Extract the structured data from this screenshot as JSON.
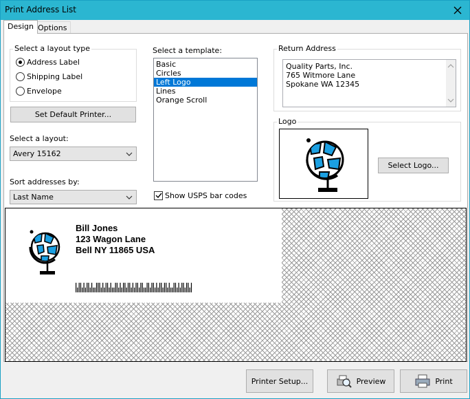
{
  "window": {
    "title": "Print Address List"
  },
  "tabs": [
    {
      "label": "Design"
    },
    {
      "label": "Options"
    }
  ],
  "layout_type": {
    "caption": "Select a layout type",
    "options": [
      {
        "label": "Address Label",
        "checked": true
      },
      {
        "label": "Shipping Label",
        "checked": false
      },
      {
        "label": "Envelope",
        "checked": false
      }
    ]
  },
  "set_default_printer_label": "Set Default Printer...",
  "layout": {
    "caption": "Select a layout:",
    "value": "Avery 15162"
  },
  "sort": {
    "caption": "Sort addresses by:",
    "value": "Last Name"
  },
  "template": {
    "caption": "Select a template:",
    "items": [
      "Basic",
      "Circles",
      "Left Logo",
      "Lines",
      "Orange Scroll"
    ],
    "selected": "Left Logo"
  },
  "usps": {
    "label": "Show USPS bar codes",
    "checked": true
  },
  "return_address": {
    "caption": "Return Address",
    "lines": [
      "Quality Parts, Inc.",
      "765 Witmore Lane",
      "Spokane WA 12345"
    ]
  },
  "logo": {
    "caption": "Logo",
    "select_label": "Select Logo...",
    "icon": "globe-icon"
  },
  "preview": {
    "address_lines": [
      "Bill Jones",
      "123 Wagon Lane",
      "Bell NY 11865 USA"
    ],
    "barcode_bars": [
      1,
      0,
      1,
      1,
      0,
      1,
      0,
      1,
      1,
      0,
      1,
      0,
      0,
      1,
      1,
      1,
      0,
      1,
      0,
      1,
      1,
      0,
      1,
      0,
      0,
      1,
      1,
      0,
      1,
      0,
      1,
      1,
      0,
      1,
      1,
      0,
      1,
      0,
      1,
      1,
      0,
      1,
      1,
      0,
      0,
      1,
      1,
      0,
      1,
      1,
      0,
      1,
      0,
      1,
      1,
      0,
      1,
      1,
      0,
      1,
      0,
      0,
      1,
      1,
      0,
      1,
      0,
      1,
      1,
      0,
      1,
      1,
      0,
      1
    ]
  },
  "buttons": {
    "printer_setup": "Printer Setup...",
    "preview": "Preview",
    "print": "Print"
  },
  "colors": {
    "titlebar": "#2bb6d1",
    "selection": "#0078d7",
    "globe_blue": "#1ba0e2"
  }
}
